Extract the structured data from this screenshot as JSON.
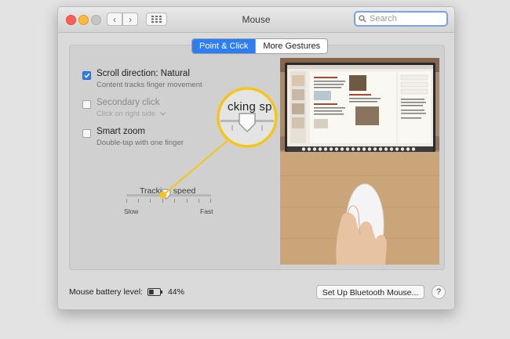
{
  "window": {
    "title": "Mouse"
  },
  "toolbar": {
    "back_glyph": "‹",
    "forward_glyph": "›"
  },
  "search": {
    "placeholder": "Search"
  },
  "tabs": [
    {
      "label": "Point & Click",
      "active": true
    },
    {
      "label": "More Gestures",
      "active": false
    }
  ],
  "options": [
    {
      "label": "Scroll direction: Natural",
      "sub": "Content tracks finger movement",
      "checked": true,
      "enabled": true
    },
    {
      "label": "Secondary click",
      "sub": "Click on right side",
      "checked": false,
      "enabled": false
    },
    {
      "label": "Smart zoom",
      "sub": "Double-tap with one finger",
      "checked": false,
      "enabled": true
    }
  ],
  "tracking": {
    "title": "Tracking speed",
    "slow_label": "Slow",
    "fast_label": "Fast",
    "level": 0.47,
    "zoom_caption": "cking sp"
  },
  "footer": {
    "battery_label": "Mouse battery level:",
    "battery_value": "44%",
    "setup_button": "Set Up Bluetooth Mouse...",
    "help_button": "?"
  },
  "colors": {
    "accent": "#2d7ef2",
    "callout": "#f5c518",
    "close": "#fc605c",
    "minimize": "#fcbb40"
  },
  "icons": {
    "search": "search-icon",
    "grid": "grid-icon",
    "battery": "battery-icon",
    "dropdown": "chevron-down-icon"
  }
}
